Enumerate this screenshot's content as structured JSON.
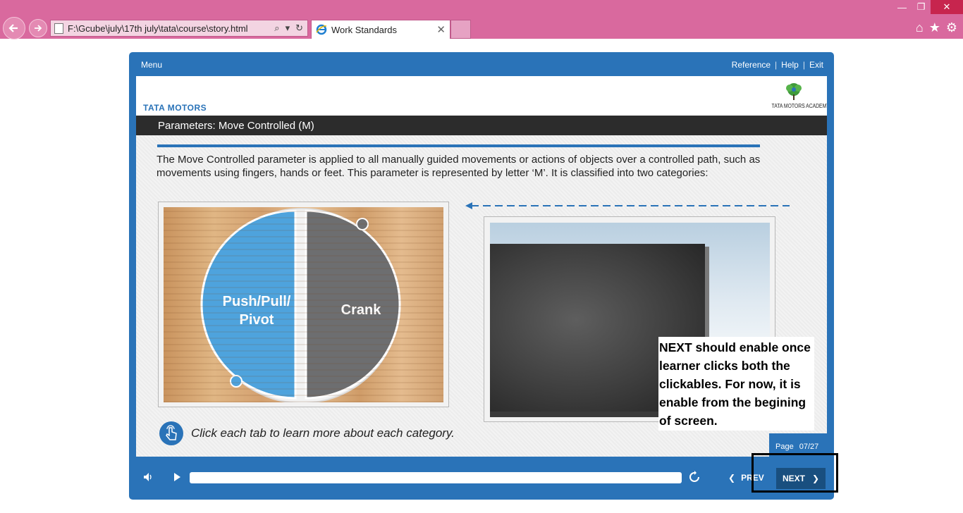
{
  "browser": {
    "address_url": "F:\\Gcube\\july\\17th july\\tata\\course\\story.html",
    "tab_title": "Work Standards"
  },
  "player": {
    "menu_label": "Menu",
    "links": {
      "reference": "Reference",
      "help": "Help",
      "exit": "Exit",
      "separator": "|"
    },
    "brand": "TATA MOTORS",
    "academy": "TATA MOTORS ACADEMY",
    "slide_title": "Parameters: Move Controlled (M)",
    "intro_text": "The Move Controlled parameter is applied to all manually guided movements or actions of objects over a controlled path, such as movements using fingers, hands or feet. This parameter is represented by letter ‘M’. It is classified into two categories:",
    "tabs": [
      {
        "label_line1": "Push/Pull/",
        "label_line2": "Pivot",
        "color": "#4ea3dd"
      },
      {
        "label": "Crank",
        "color": "#6d6e70"
      }
    ],
    "note_text": "NEXT should enable once learner clicks both the clickables. For now, it is enable from the begining of screen.",
    "hint_text": "Click each tab to learn more about each category.",
    "page": {
      "label": "Page",
      "value": "07/27"
    },
    "controls": {
      "prev_label": "PREV",
      "next_label": "NEXT",
      "progress": 0.0
    },
    "accent_color": "#2a73b8"
  }
}
